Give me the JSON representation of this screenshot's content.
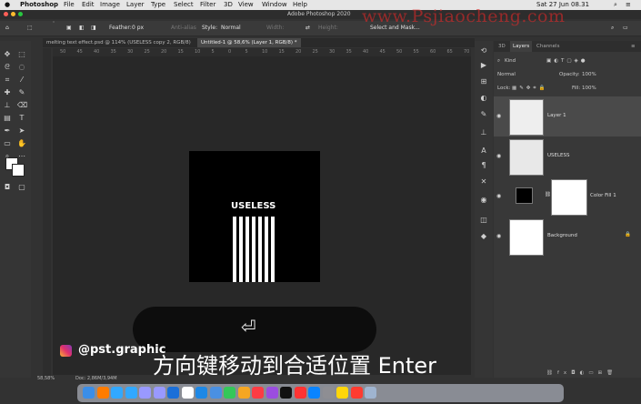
{
  "menubar": {
    "app": "Photoshop",
    "items": [
      "File",
      "Edit",
      "Image",
      "Layer",
      "Type",
      "Select",
      "Filter",
      "3D",
      "View",
      "Window",
      "Help"
    ],
    "clock": "Sat 27 Jun 08.31"
  },
  "window": {
    "title": "Adobe Photoshop 2020"
  },
  "options": {
    "feather_label": "Feather:",
    "feather_value": "0 px",
    "antialias": "Anti-alias",
    "style_label": "Style:",
    "style_value": "Normal",
    "width_label": "Width:",
    "height_label": "Height:",
    "select_mask": "Select and Mask..."
  },
  "doc_tabs": [
    {
      "label": "melting text effect.psd @ 114% (USELESS copy 2, RGB/8)"
    },
    {
      "label": "Untitled-1 @ 58,6% (Layer 1, RGB/8) *"
    }
  ],
  "ruler_ticks": [
    "50",
    "45",
    "40",
    "35",
    "30",
    "25",
    "20",
    "15",
    "10",
    "5",
    "0",
    "5",
    "10",
    "15",
    "20",
    "25",
    "30",
    "35",
    "40",
    "45",
    "50",
    "55",
    "60",
    "65",
    "70"
  ],
  "canvas_text": "USELESS",
  "layers_panel": {
    "tabs": [
      "3D",
      "Layers",
      "Channels"
    ],
    "kind": "Kind",
    "blend": "Normal",
    "opacity_label": "Opacity:",
    "opacity": "100%",
    "lock_label": "Lock:",
    "fill_label": "Fill:",
    "fill": "100%",
    "layers": [
      {
        "name": "Layer 1"
      },
      {
        "name": "USELESS"
      },
      {
        "name": "Color Fill 1"
      },
      {
        "name": "Background"
      }
    ]
  },
  "status": {
    "zoom": "58,58%",
    "doc": "Doc: 2,86M/3,94M"
  },
  "overlay": {
    "handle": "@pst.graphic",
    "subtitle": "方向键移动到合适位置 Enter",
    "watermark": "www.Psjiaocheng.com"
  },
  "dock_icons": [
    "finder-icon",
    "ai-icon",
    "ps-icon",
    "lr-icon",
    "pr-icon",
    "ae-icon",
    "c4d-icon",
    "chrome-icon",
    "safari-icon",
    "mail-icon",
    "messages-icon",
    "photos-icon",
    "music-icon",
    "podcasts-icon",
    "appletv-icon",
    "news-icon",
    "appstore-icon",
    "settings-icon",
    "notes-icon",
    "calendar-icon",
    "trash-icon"
  ],
  "colors": {
    "accent": "#e12424",
    "panel": "#383838"
  }
}
